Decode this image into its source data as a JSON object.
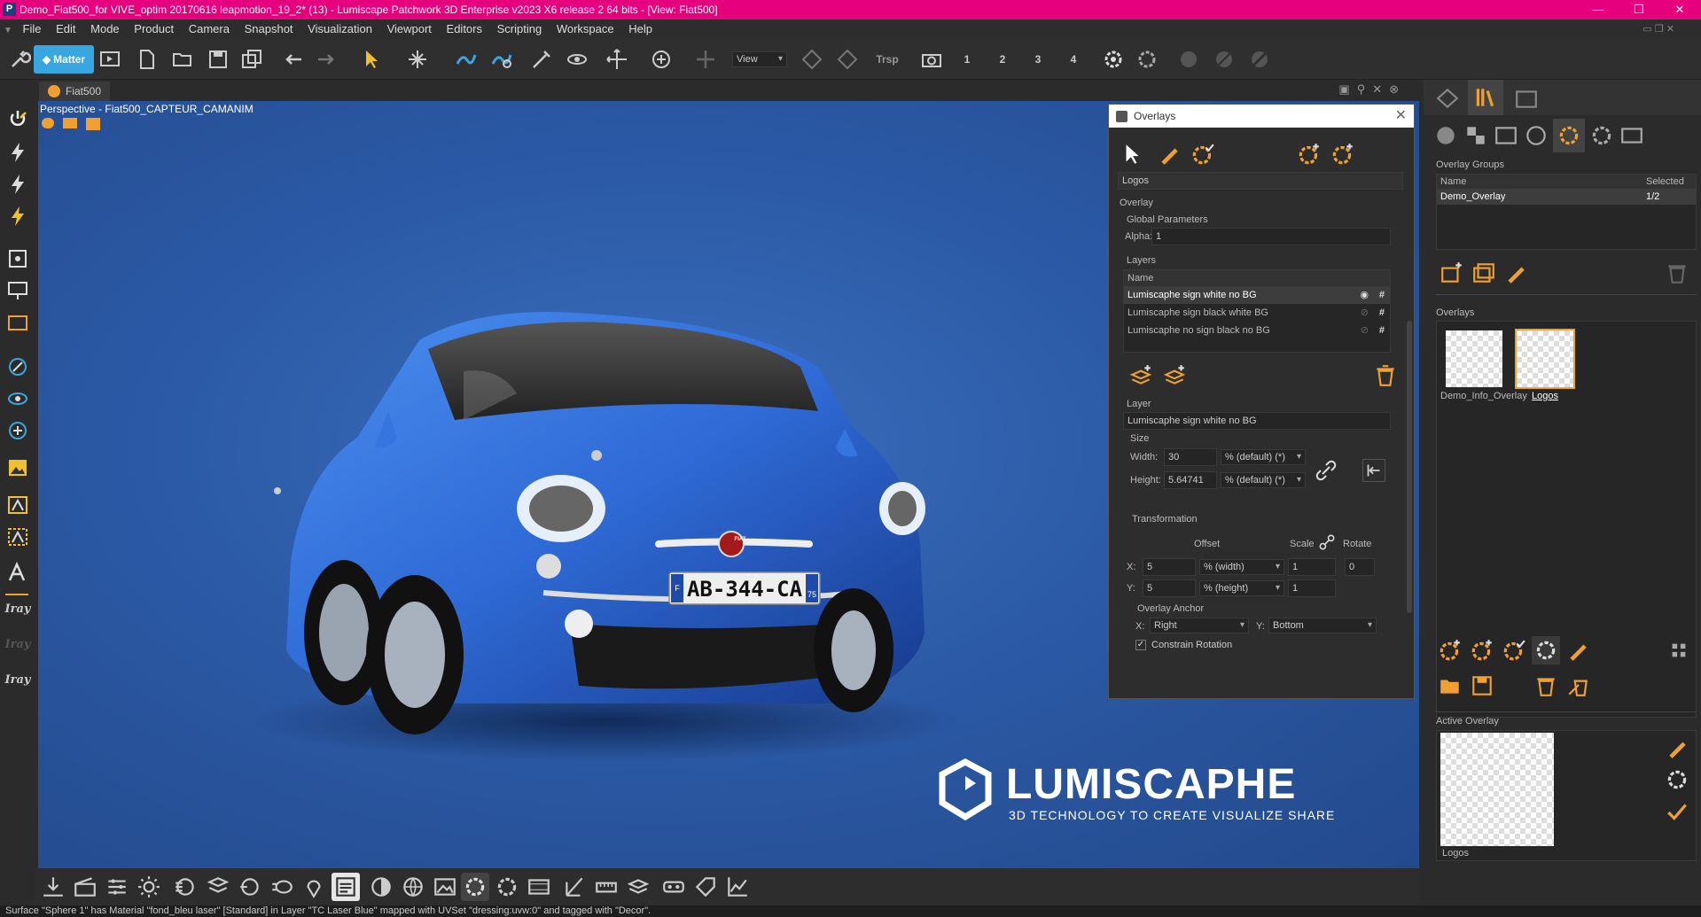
{
  "window": {
    "title": "Demo_Fiat500_for VIVE_optim 20170616 leapmotion_19_2* (13) - Lumiscape Patchwork 3D Enterprise v2023 X6 release 2 64 bits - [View: Fiat500]",
    "app_icon": "P",
    "minimize": "—",
    "maximize": "❐",
    "close": "✕"
  },
  "menu": [
    "File",
    "Edit",
    "Mode",
    "Product",
    "Camera",
    "Snapshot",
    "Visualization",
    "Viewport",
    "Editors",
    "Scripting",
    "Workspace",
    "Help"
  ],
  "toolbar": {
    "matter_label": "Matter",
    "trsp_label": "Trsp",
    "view_select": "View",
    "cam_numbers": [
      "1",
      "2",
      "3",
      "4"
    ]
  },
  "tab": {
    "label": "Fiat500"
  },
  "viewport": {
    "label": "Perspective - Fiat500_CAPTEUR_CAMANIM",
    "plate": "AB-344-CA",
    "plate_country": "F",
    "plate_dept": "75",
    "badge": "FIAT",
    "logo_text": "LUMISCAPHE",
    "logo_tagline": "3D TECHNOLOGY TO  CREATE  VISUALIZE  SHARE"
  },
  "left_toolbar": {
    "iray_labels": [
      "Iray",
      "Iray",
      "Iray"
    ]
  },
  "overlays_window": {
    "title": "Overlays",
    "overlay_name": "Logos",
    "overlay_section": "Overlay",
    "global_parameters": "Global Parameters",
    "alpha_label": "Alpha:",
    "alpha_value": "1",
    "layers_section": "Layers",
    "layers_header": "Name",
    "layers": [
      {
        "name": "Lumiscaphe sign white no BG",
        "selected": true
      },
      {
        "name": "Lumiscaphe sign black white BG",
        "selected": false
      },
      {
        "name": "Lumiscaphe no sign black no BG",
        "selected": false
      }
    ],
    "layer_section": "Layer",
    "layer_name": "Lumiscaphe sign white no BG",
    "size_section": "Size",
    "width_label": "Width:",
    "width_value": "30",
    "width_unit": "% (default) (*)",
    "height_label": "Height:",
    "height_value": "5.64741",
    "height_unit": "% (default) (*)",
    "transformation_section": "Transformation",
    "offset_label": "Offset",
    "scale_label": "Scale",
    "rotate_label": "Rotate",
    "x_label": "X:",
    "x_offset": "5",
    "x_unit": "% (width)",
    "x_scale": "1",
    "rotate_value": "0",
    "y_label": "Y:",
    "y_offset": "5",
    "y_unit": "% (height)",
    "y_scale": "1",
    "anchor_section": "Overlay Anchor",
    "anchor_x_label": "X:",
    "anchor_x": "Right",
    "anchor_y_label": "Y:",
    "anchor_y": "Bottom",
    "constrain_rotation": "Constrain Rotation",
    "constrain_checked": true
  },
  "right_panel": {
    "overlay_groups_title": "Overlay Groups",
    "col_name": "Name",
    "col_selected": "Selected",
    "groups": [
      {
        "name": "Demo_Overlay",
        "selected": "1/2"
      }
    ],
    "overlays_title": "Overlays",
    "overlay_thumbs": [
      {
        "name": "Demo_Info_Overlay",
        "selected": false
      },
      {
        "name": "Logos",
        "selected": true
      }
    ],
    "active_overlay_title": "Active Overlay",
    "active_overlay_name": "Logos"
  },
  "status": "Surface \"Sphere 1\" has Material \"fond_bleu laser\" [Standard] in Layer \"TC Laser Blue\" mapped with UVSet \"dressing:uvw:0\" and tagged with \"Decor\".",
  "colors": {
    "accent": "#e6007e",
    "icon_orange": "#f0a030",
    "icon_blue": "#3aa6e0",
    "viewport_bg": "#2c5aa6"
  }
}
